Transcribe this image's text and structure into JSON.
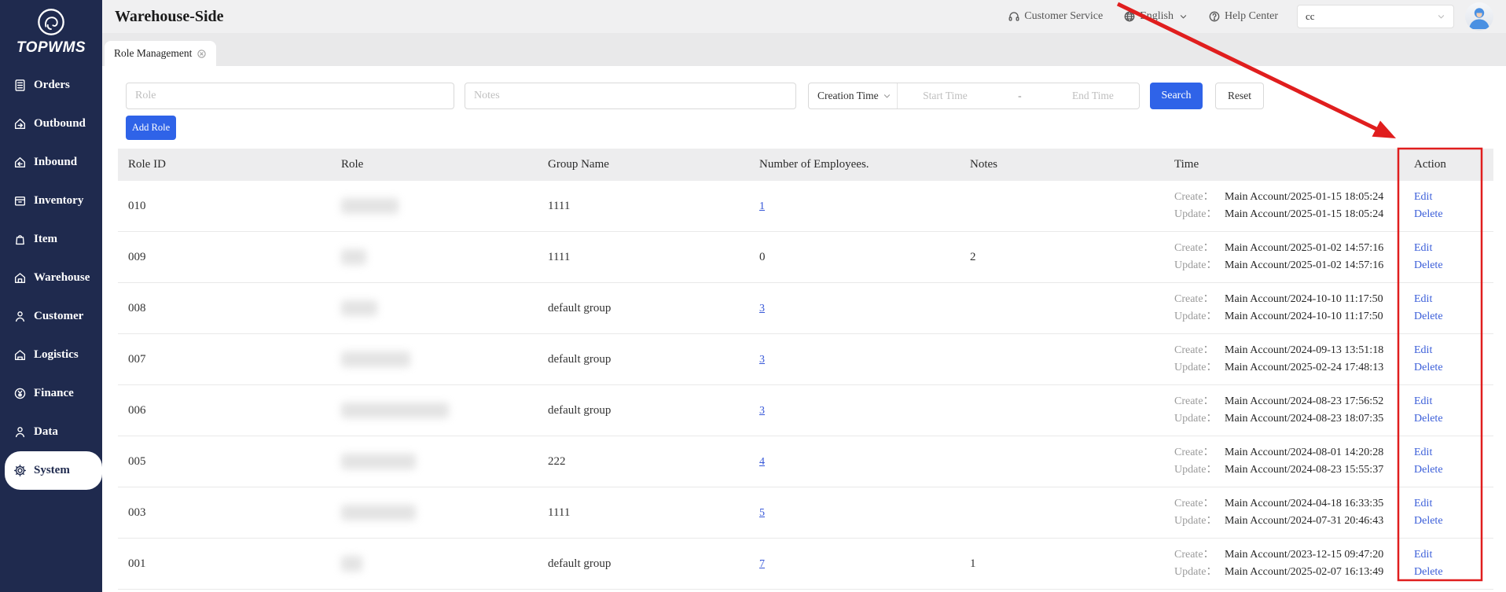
{
  "brand": {
    "logo_text": "TOPWMS",
    "logo_icon": "elephant-logo-icon"
  },
  "sidebar": {
    "items": [
      {
        "label": "Orders",
        "icon": "orders-icon",
        "active": false
      },
      {
        "label": "Outbound",
        "icon": "outbound-icon",
        "active": false
      },
      {
        "label": "Inbound",
        "icon": "inbound-icon",
        "active": false
      },
      {
        "label": "Inventory",
        "icon": "inventory-icon",
        "active": false
      },
      {
        "label": "Item",
        "icon": "item-icon",
        "active": false
      },
      {
        "label": "Warehouse",
        "icon": "warehouse-icon",
        "active": false
      },
      {
        "label": "Customer",
        "icon": "customer-icon",
        "active": false
      },
      {
        "label": "Logistics",
        "icon": "logistics-icon",
        "active": false
      },
      {
        "label": "Finance",
        "icon": "finance-icon",
        "active": false
      },
      {
        "label": "Data",
        "icon": "data-icon",
        "active": false
      },
      {
        "label": "System",
        "icon": "system-icon",
        "active": true
      }
    ]
  },
  "header": {
    "title": "Warehouse-Side",
    "customer_service": "Customer Service",
    "language": "English",
    "help_center": "Help Center",
    "account_value": "cc"
  },
  "tabs": [
    {
      "label": "Role Management"
    }
  ],
  "filters": {
    "role_placeholder": "Role",
    "notes_placeholder": "Notes",
    "time_type": "Creation Time",
    "start_placeholder": "Start Time",
    "range_separator": "-",
    "end_placeholder": "End Time",
    "search_label": "Search",
    "reset_label": "Reset"
  },
  "toolbar": {
    "add_role": "Add Role"
  },
  "table": {
    "columns": [
      "Role ID",
      "Role",
      "Group Name",
      "Number of Employees.",
      "Notes",
      "Time",
      "Action"
    ],
    "create_label": "Create：",
    "update_label": "Update：",
    "edit_label": "Edit",
    "delete_label": "Delete",
    "rows": [
      {
        "role_id": "010",
        "redacted_width": 73,
        "group_name": "1111",
        "employees": "1",
        "employees_is_link": true,
        "notes": "",
        "create": "Main Account/2025-01-15 18:05:24",
        "update": "Main Account/2025-01-15 18:05:24"
      },
      {
        "role_id": "009",
        "redacted_width": 32,
        "group_name": "1111",
        "employees": "0",
        "employees_is_link": false,
        "notes": "2",
        "create": "Main Account/2025-01-02 14:57:16",
        "update": "Main Account/2025-01-02 14:57:16"
      },
      {
        "role_id": "008",
        "redacted_width": 46,
        "group_name": "default group",
        "employees": "3",
        "employees_is_link": true,
        "notes": "",
        "create": "Main Account/2024-10-10 11:17:50",
        "update": "Main Account/2024-10-10 11:17:50"
      },
      {
        "role_id": "007",
        "redacted_width": 88,
        "group_name": "default group",
        "employees": "3",
        "employees_is_link": true,
        "notes": "",
        "create": "Main Account/2024-09-13 13:51:18",
        "update": "Main Account/2025-02-24 17:48:13"
      },
      {
        "role_id": "006",
        "redacted_width": 137,
        "group_name": "default group",
        "employees": "3",
        "employees_is_link": true,
        "notes": "",
        "create": "Main Account/2024-08-23 17:56:52",
        "update": "Main Account/2024-08-23 18:07:35"
      },
      {
        "role_id": "005",
        "redacted_width": 95,
        "group_name": "222",
        "employees": "4",
        "employees_is_link": true,
        "notes": "",
        "create": "Main Account/2024-08-01 14:20:28",
        "update": "Main Account/2024-08-23 15:55:37"
      },
      {
        "role_id": "003",
        "redacted_width": 95,
        "group_name": "1111",
        "employees": "5",
        "employees_is_link": true,
        "notes": "",
        "create": "Main Account/2024-04-18 16:33:35",
        "update": "Main Account/2024-07-31 20:46:43"
      },
      {
        "role_id": "001",
        "redacted_width": 27,
        "group_name": "default group",
        "employees": "7",
        "employees_is_link": true,
        "notes": "1",
        "create": "Main Account/2023-12-15 09:47:20",
        "update": "Main Account/2025-02-07 16:13:49"
      }
    ]
  },
  "annotations": {
    "color": "#e01e1e"
  }
}
